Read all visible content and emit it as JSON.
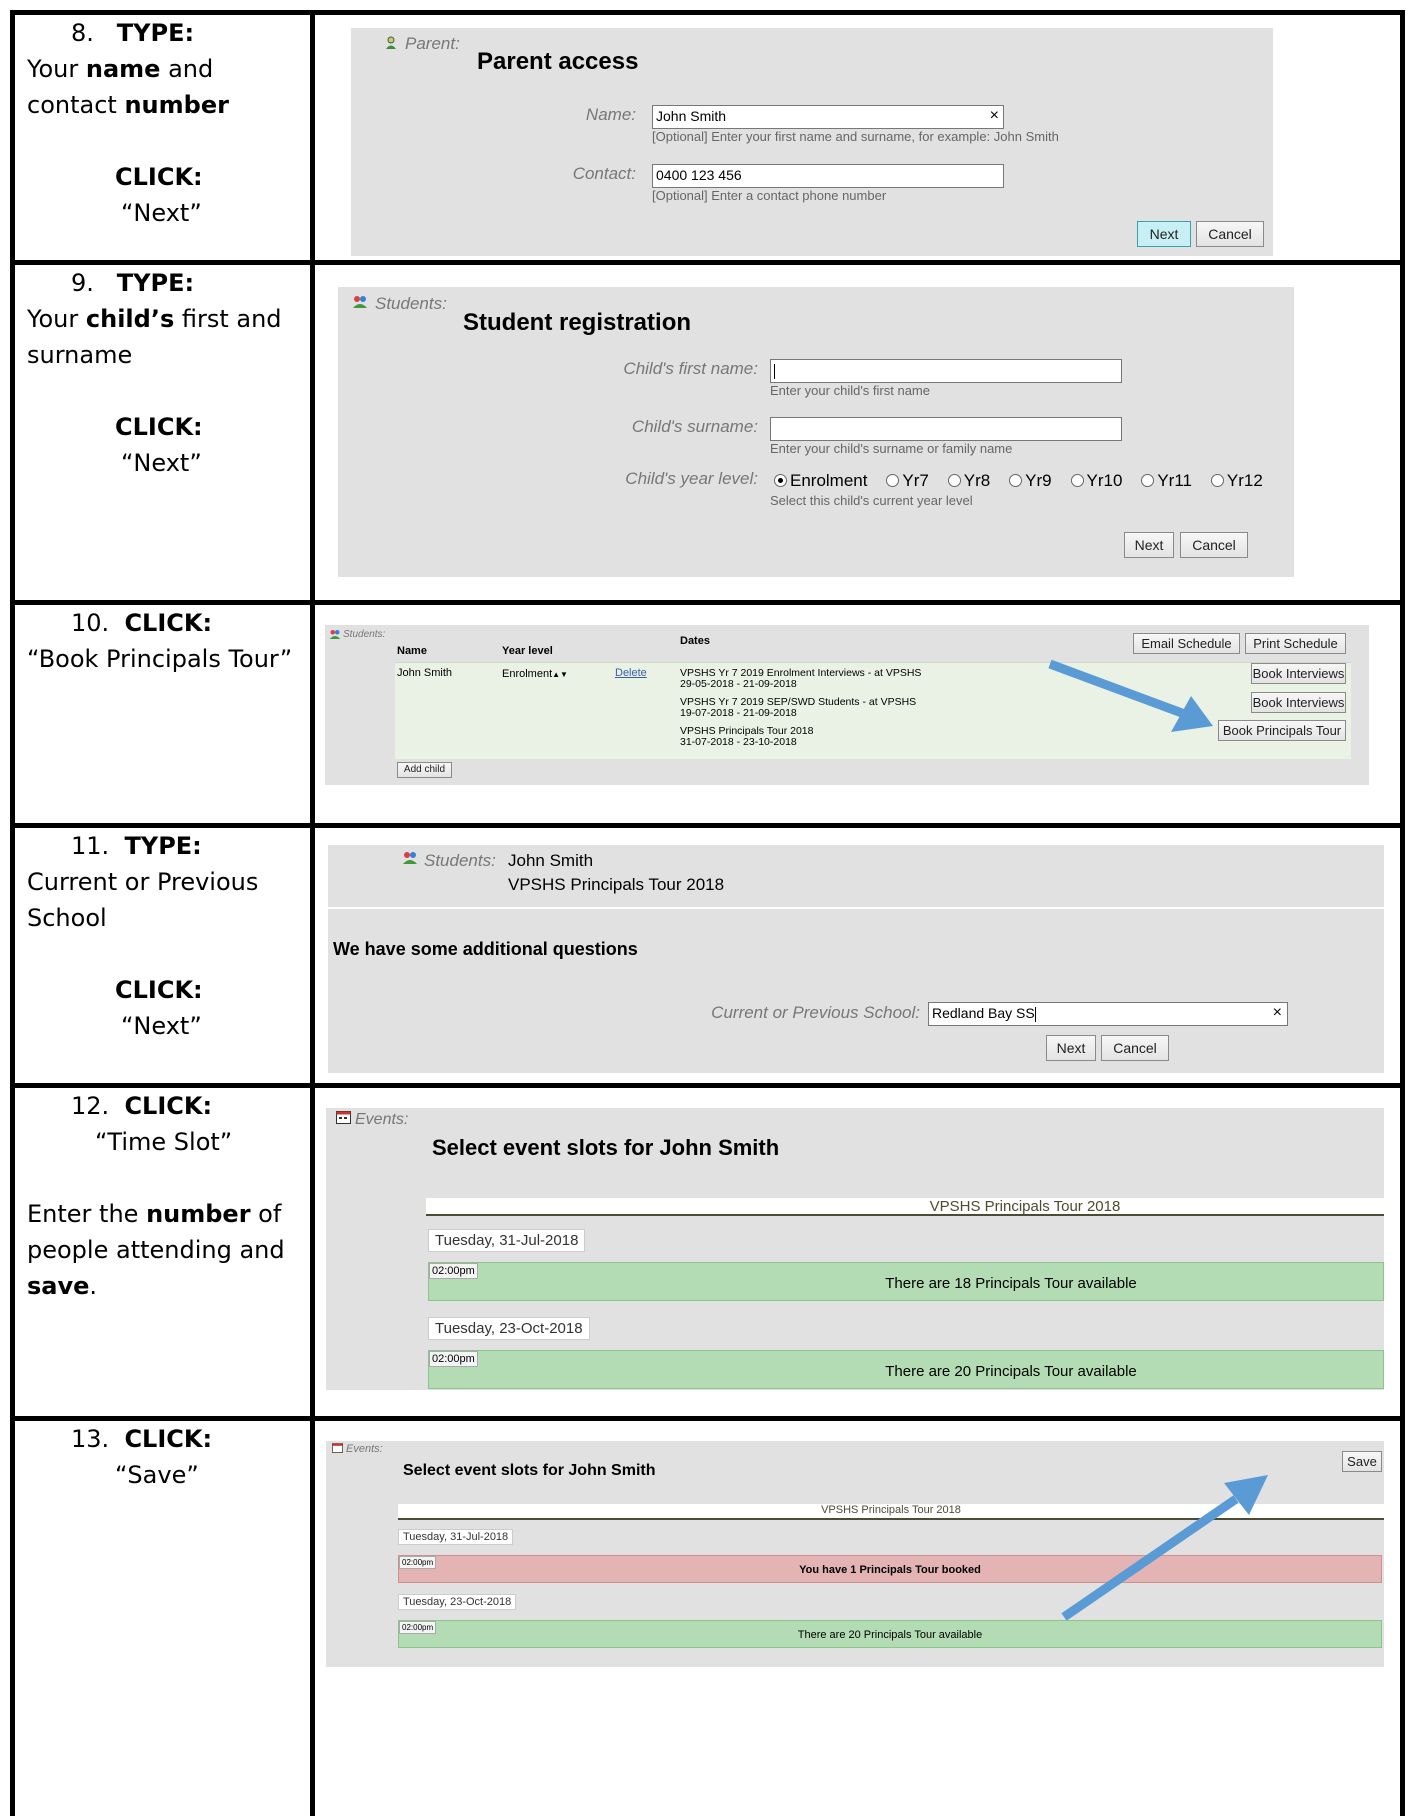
{
  "colors": {
    "panel": "#e1e1e1",
    "slot_available": "#b4dcb4",
    "slot_booked": "#e4b3b3",
    "next_highlight": "#c6f0f6",
    "arrow": "#5b9bd5"
  },
  "steps": [
    {
      "number": "8.",
      "action": "TYPE:",
      "lines": [
        [
          "Your ",
          "name",
          " and"
        ],
        [
          "contact ",
          "number",
          ""
        ]
      ],
      "click_label": "CLICK:",
      "click_target": "“Next”",
      "screen": {
        "section": "Parent:",
        "title": "Parent access",
        "name_label": "Name:",
        "name_value": "John Smith",
        "name_help": "[Optional] Enter your first name and surname, for example: John Smith",
        "contact_label": "Contact:",
        "contact_value": "0400 123 456",
        "contact_help": "[Optional] Enter a contact phone number",
        "next": "Next",
        "cancel": "Cancel",
        "clear": "×"
      }
    },
    {
      "number": "9.",
      "action": "TYPE:",
      "lines": [
        [
          "Your ",
          "child’s",
          " first and"
        ],
        [
          "surname",
          "",
          ""
        ]
      ],
      "click_label": "CLICK:",
      "click_target": "“Next”",
      "screen": {
        "section": "Students:",
        "title": "Student registration",
        "first_label": "Child's first name:",
        "first_help": "Enter your child's first name",
        "surname_label": "Child's surname:",
        "surname_help": "Enter your child's surname or family name",
        "year_label": "Child's year level:",
        "year_help": "Select this child's current year level",
        "year_options": [
          "Enrolment",
          "Yr7",
          "Yr8",
          "Yr9",
          "Yr10",
          "Yr11",
          "Yr12"
        ],
        "year_selected": "Enrolment",
        "next": "Next",
        "cancel": "Cancel"
      }
    },
    {
      "number": "10.",
      "action": "CLICK:",
      "lines": [
        [
          "“Book Principals Tour”",
          "",
          ""
        ]
      ],
      "screen": {
        "section": "Students:",
        "col_name": "Name",
        "col_year": "Year level",
        "col_dates": "Dates",
        "email_btn": "Email Schedule",
        "print_btn": "Print Schedule",
        "child_name": "John Smith",
        "child_year": "Enrolment",
        "delete": "Delete",
        "events": [
          {
            "title": "VPSHS Yr 7 2019 Enrolment Interviews - at VPSHS",
            "dates": "29-05-2018 - 21-09-2018",
            "button": "Book Interviews"
          },
          {
            "title": "VPSHS Yr 7 2019 SEP/SWD Students - at VPSHS",
            "dates": "19-07-2018 - 21-09-2018",
            "button": "Book Interviews"
          },
          {
            "title": "VPSHS Principals Tour 2018",
            "dates": "31-07-2018 - 23-10-2018",
            "button": "Book Principals Tour"
          }
        ],
        "add_child": "Add child"
      }
    },
    {
      "number": "11.",
      "action": "TYPE:",
      "lines": [
        [
          "Current or Previous",
          "",
          ""
        ],
        [
          "School",
          "",
          ""
        ]
      ],
      "click_label": "CLICK:",
      "click_target": "“Next”",
      "screen": {
        "section": "Students:",
        "student": "John Smith",
        "event": "VPSHS Principals Tour 2018",
        "heading": "We have some additional questions",
        "school_label": "Current or Previous School:",
        "school_value": "Redland Bay SS",
        "next": "Next",
        "cancel": "Cancel",
        "clear": "×"
      }
    },
    {
      "number": "12.",
      "action": "CLICK:",
      "sub": "“Time Slot”",
      "lines": [
        [
          "Enter the ",
          "number",
          " of"
        ],
        [
          "people attending and",
          "",
          ""
        ],
        [
          "",
          "save",
          "."
        ]
      ],
      "screen": {
        "section": "Events:",
        "title": "Select event slots for John Smith",
        "event": "VPSHS Principals Tour 2018",
        "days": [
          {
            "date": "Tuesday, 31-Jul-2018",
            "time": "02:00pm",
            "text": "There are 18 Principals Tour available"
          },
          {
            "date": "Tuesday, 23-Oct-2018",
            "time": "02:00pm",
            "text": "There are 20 Principals Tour available"
          }
        ]
      }
    },
    {
      "number": "13.",
      "action": "CLICK:",
      "sub": "“Save”",
      "screen": {
        "section": "Events:",
        "title": "Select event slots for John Smith",
        "save": "Save",
        "event": "VPSHS Principals Tour 2018",
        "days": [
          {
            "date": "Tuesday, 31-Jul-2018",
            "time": "02:00pm",
            "text": "You have 1 Principals Tour booked",
            "booked": true
          },
          {
            "date": "Tuesday, 23-Oct-2018",
            "time": "02:00pm",
            "text": "There are 20 Principals Tour available",
            "booked": false
          }
        ]
      }
    }
  ]
}
